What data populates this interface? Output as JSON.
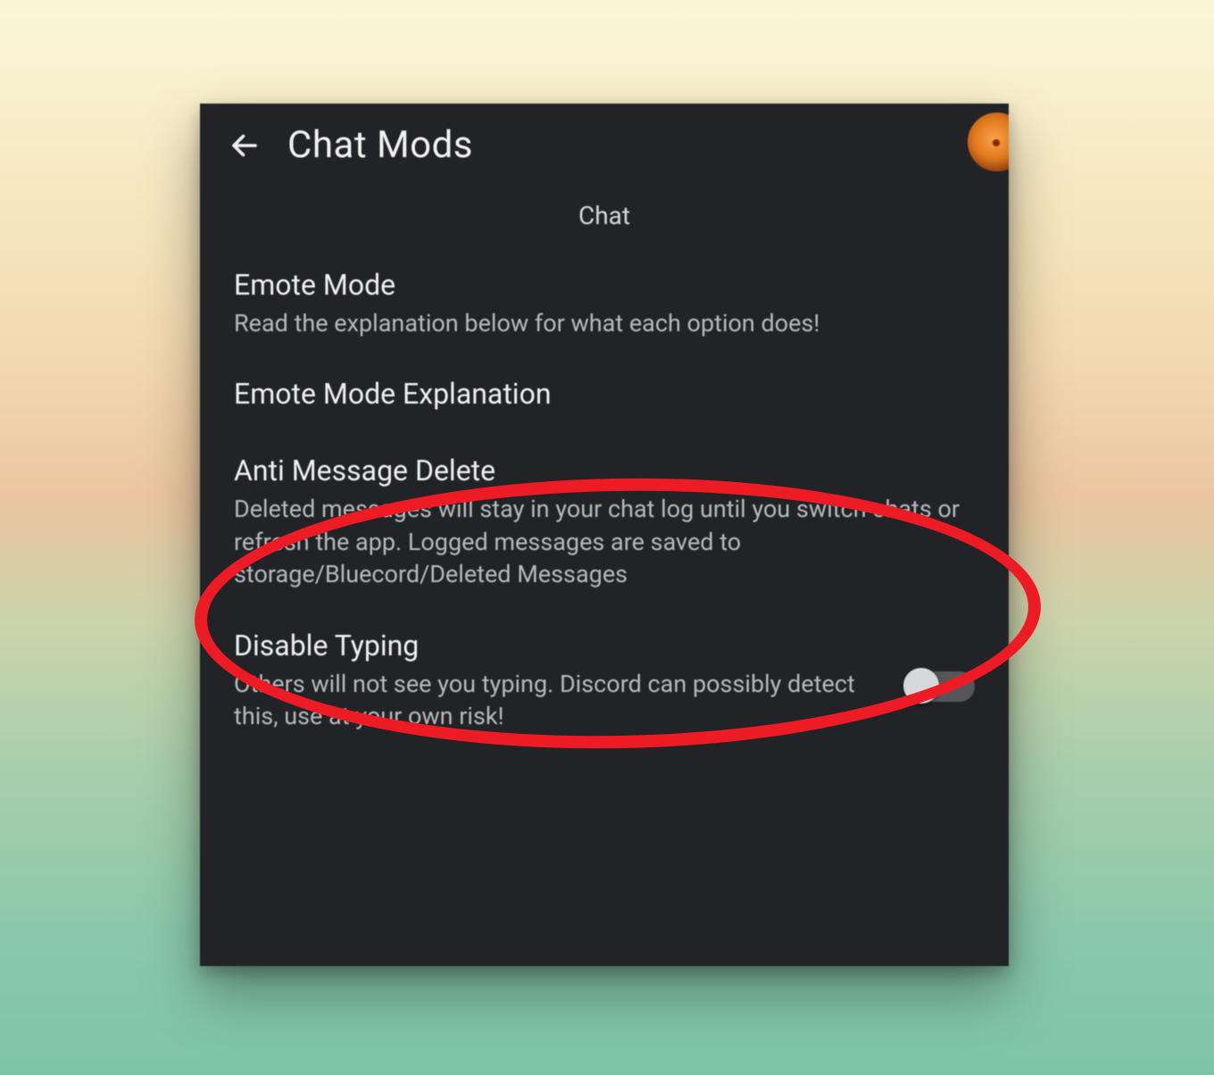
{
  "header": {
    "title": "Chat Mods"
  },
  "section": {
    "label": "Chat"
  },
  "settings": {
    "emote_mode": {
      "title": "Emote Mode",
      "desc": "Read the explanation below for what each option does!"
    },
    "emote_mode_explanation": {
      "title": "Emote Mode Explanation"
    },
    "anti_message_delete": {
      "title": "Anti Message Delete",
      "desc": "Deleted messages will stay in your chat log until you switch chats or refresh the app. Logged messages are saved to storage/Bluecord/Deleted Messages"
    },
    "disable_typing": {
      "title": "Disable Typing",
      "desc": "Others will not see you typing. Discord can possibly detect this, use at your own risk!",
      "toggle_state": "off"
    }
  }
}
